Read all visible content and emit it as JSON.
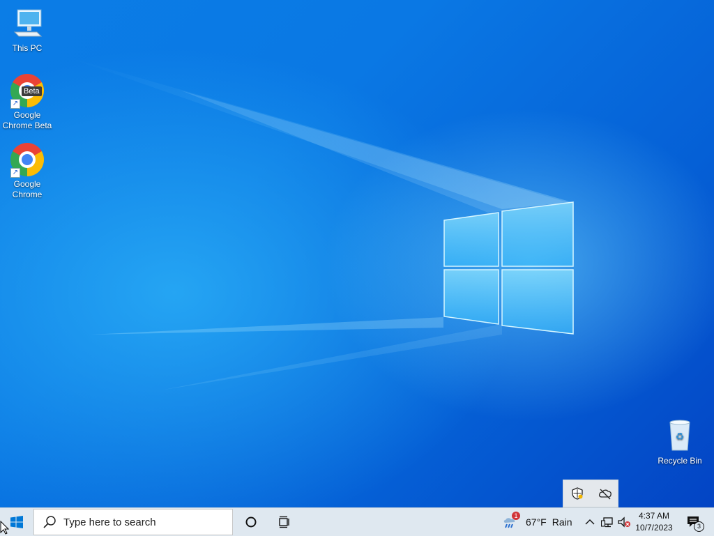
{
  "desktop": {
    "icons": [
      {
        "name": "this-pc",
        "label": "This PC"
      },
      {
        "name": "google-chrome-beta",
        "label": "Google Chrome Beta",
        "badge": "Beta"
      },
      {
        "name": "google-chrome",
        "label": "Google Chrome"
      },
      {
        "name": "recycle-bin",
        "label": "Recycle Bin"
      }
    ]
  },
  "taskbar": {
    "search": {
      "placeholder": "Type here to search"
    },
    "weather": {
      "temperature": "67°F",
      "condition": "Rain",
      "alert_count": "1"
    },
    "clock": {
      "time": "4:37 AM",
      "date": "10/7/2023"
    },
    "notifications": {
      "count": "3"
    }
  },
  "colors": {
    "desktop_background": "#0a6fe0",
    "taskbar_background": "#dfe8f0",
    "start_icon": "#0078d7",
    "alert_badge": "#d13438"
  },
  "icons": {
    "start": "windows-logo-icon",
    "search": "magnifier-icon",
    "cortana": "circle-icon",
    "task_view": "task-view-icon",
    "weather": "rain-cloud-icon",
    "tray_overflow": "chevron-up-icon",
    "network": "network-icon",
    "volume": "volume-muted-icon",
    "notification": "action-center-icon",
    "security": "shield-icon",
    "onedrive": "cloud-offline-icon"
  }
}
